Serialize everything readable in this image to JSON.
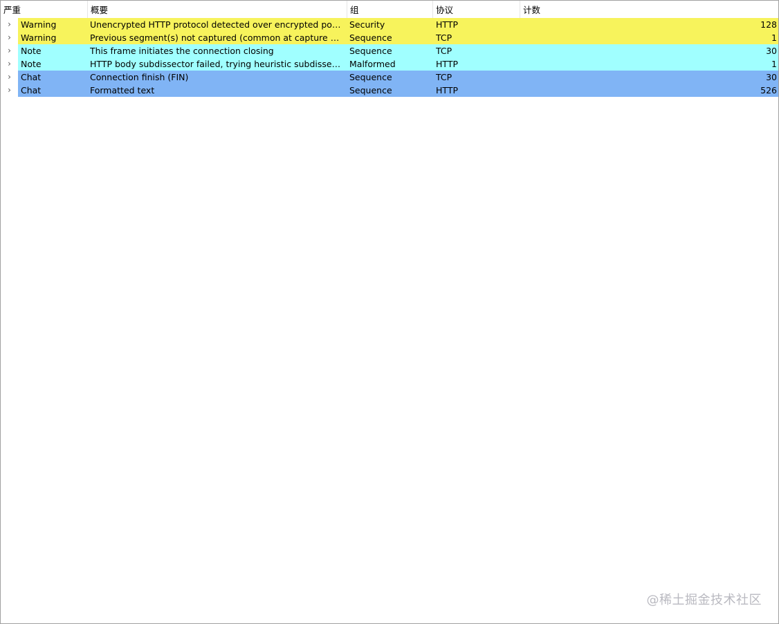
{
  "columns": {
    "severity": "严重",
    "summary": "概要",
    "group": "组",
    "protocol": "协议",
    "count": "计数"
  },
  "sort_indicator": "﹀",
  "rows": [
    {
      "severity": "Warning",
      "summary": "Unencrypted HTTP protocol detected over encrypted port, c...",
      "group": "Security",
      "protocol": "HTTP",
      "count": "128",
      "color": "#f7f35c"
    },
    {
      "severity": "Warning",
      "summary": "Previous segment(s) not captured (common at capture start)",
      "group": "Sequence",
      "protocol": "TCP",
      "count": "1",
      "color": "#f7f35c"
    },
    {
      "severity": "Note",
      "summary": "This frame initiates the connection closing",
      "group": "Sequence",
      "protocol": "TCP",
      "count": "30",
      "color": "#a0ffff"
    },
    {
      "severity": "Note",
      "summary": "HTTP body subdissector failed, trying heuristic subdissector",
      "group": "Malformed",
      "protocol": "HTTP",
      "count": "1",
      "color": "#a0ffff"
    },
    {
      "severity": "Chat",
      "summary": "Connection finish (FIN)",
      "group": "Sequence",
      "protocol": "TCP",
      "count": "30",
      "color": "#80b4f5"
    },
    {
      "severity": "Chat",
      "summary": "Formatted text",
      "group": "Sequence",
      "protocol": "HTTP",
      "count": "526",
      "color": "#80b4f5"
    }
  ],
  "expander_glyph": "›",
  "watermark": "@稀土掘金技术社区"
}
